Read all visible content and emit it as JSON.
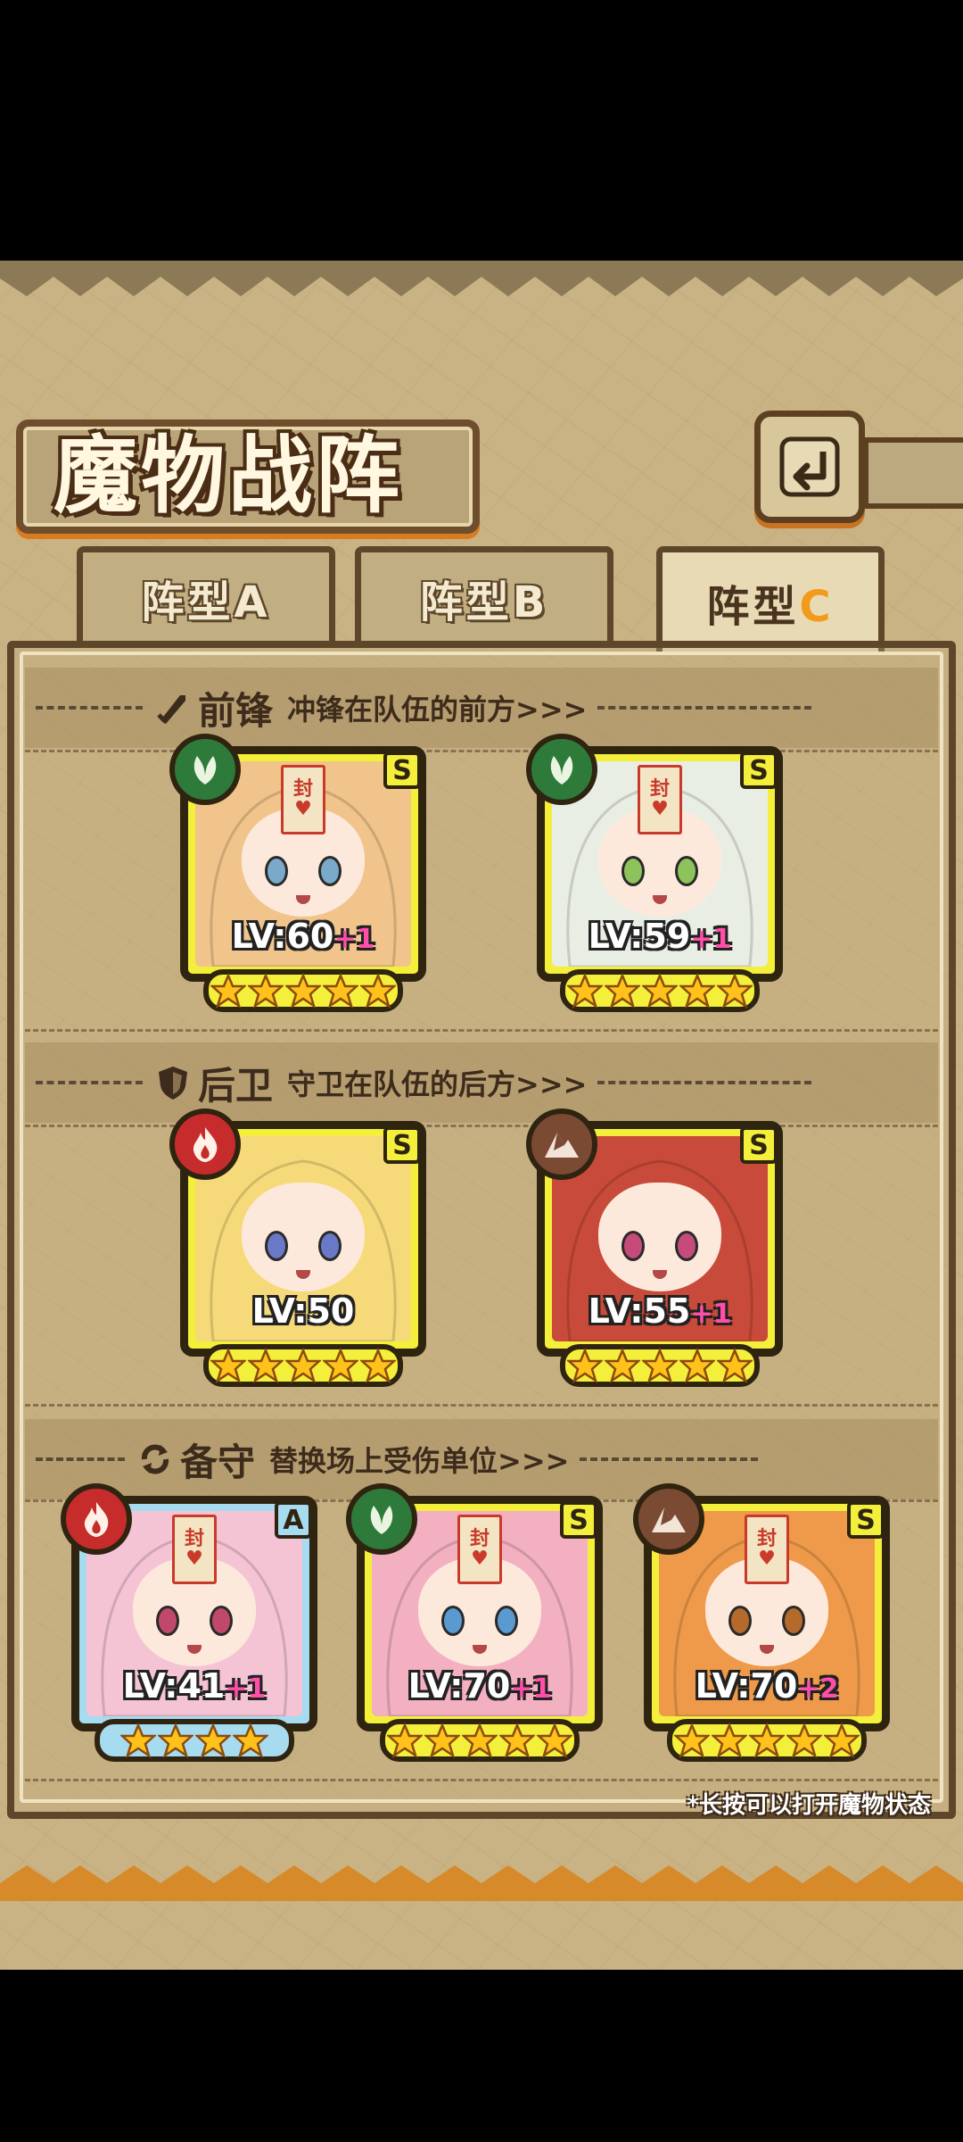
{
  "title": "魔物战阵",
  "tabs": [
    {
      "label": "阵型",
      "letter": "A",
      "active": false
    },
    {
      "label": "阵型",
      "letter": "B",
      "active": false
    },
    {
      "label": "阵型",
      "letter": "C",
      "active": true
    }
  ],
  "sections": {
    "front": {
      "title": "前锋",
      "subtitle": "冲锋在队伍的前方>>>",
      "icon": "sword-icon"
    },
    "rear": {
      "title": "后卫",
      "subtitle": "守卫在队伍的后方>>>",
      "icon": "shield-icon"
    },
    "reserve": {
      "title": "备守",
      "subtitle": "替换场上受伤单位>>>",
      "icon": "swap-icon"
    }
  },
  "cards": {
    "front": [
      {
        "element": "leaf",
        "rank": "S",
        "level": "LV:60",
        "plus": "+1",
        "stars": 5,
        "sealed": true,
        "hair": "#f0c48a",
        "eyes": "#7aa9c9"
      },
      {
        "element": "leaf",
        "rank": "S",
        "level": "LV:59",
        "plus": "+1",
        "stars": 5,
        "sealed": true,
        "hair": "#e9eee4",
        "eyes": "#8ec25a"
      }
    ],
    "rear": [
      {
        "element": "fire",
        "rank": "S",
        "level": "LV:50",
        "plus": "",
        "stars": 5,
        "sealed": false,
        "hair": "#f6da7a",
        "eyes": "#6a78c8"
      },
      {
        "element": "earth",
        "rank": "S",
        "level": "LV:55",
        "plus": "+1",
        "stars": 5,
        "sealed": false,
        "hair": "#c84a3a",
        "eyes": "#c64b7a"
      }
    ],
    "reserve": [
      {
        "element": "fire",
        "rank": "A",
        "level": "LV:41",
        "plus": "+1",
        "stars": 4,
        "sealed": true,
        "hair": "#f4c4d4",
        "eyes": "#c0486a"
      },
      {
        "element": "leaf",
        "rank": "S",
        "level": "LV:70",
        "plus": "+1",
        "stars": 5,
        "sealed": true,
        "hair": "#f2b0c0",
        "eyes": "#5a9ad0"
      },
      {
        "element": "earth",
        "rank": "S",
        "level": "LV:70",
        "plus": "+2",
        "stars": 5,
        "sealed": true,
        "hair": "#ee9a4a",
        "eyes": "#b46a2a"
      }
    ]
  },
  "footer_note": "*长按可以打开魔物状态",
  "icons": {
    "back": "back-arrow-icon",
    "leaf": "leaf-icon",
    "fire": "fire-icon",
    "earth": "earth-icon",
    "star": "star-icon"
  }
}
